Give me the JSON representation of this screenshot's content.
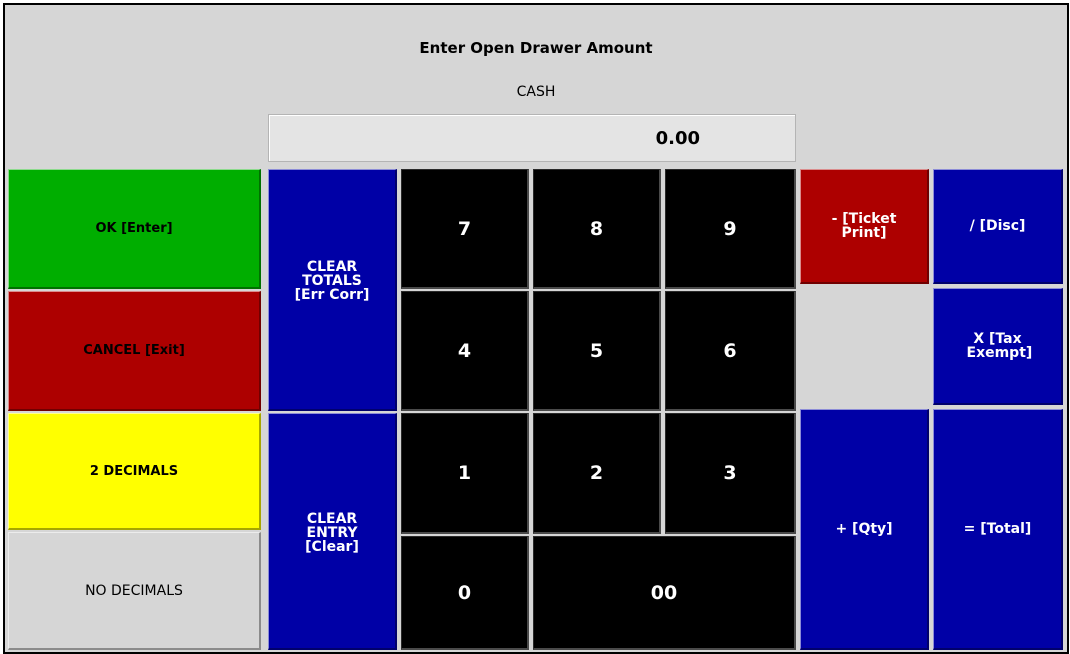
{
  "dialog": {
    "title": "Enter Open Drawer Amount",
    "subtitle": "CASH",
    "amount": "0.00"
  },
  "left_buttons": {
    "ok": "OK [Enter]",
    "cancel": "CANCEL [Exit]",
    "two_decimals": "2 DECIMALS",
    "no_decimals": "NO DECIMALS"
  },
  "clear_buttons": {
    "clear_totals": "CLEAR TOTALS [Err Corr]",
    "clear_entry": "CLEAR ENTRY [Clear]"
  },
  "keypad": {
    "k7": "7",
    "k8": "8",
    "k9": "9",
    "k4": "4",
    "k5": "5",
    "k6": "6",
    "k1": "1",
    "k2": "2",
    "k3": "3",
    "k0": "0",
    "k00": "00"
  },
  "function_buttons": {
    "minus": "- [Ticket Print]",
    "divide": "/ [Disc]",
    "multiply": "X [Tax Exempt]",
    "plus": "+ [Qty]",
    "equals": "= [Total]"
  },
  "colors": {
    "green": "#00ae00",
    "red": "#ad0000",
    "yellow": "#ffff00",
    "blue": "#0000a6",
    "keypad": "#000000",
    "gray": "#d6d6d6"
  }
}
